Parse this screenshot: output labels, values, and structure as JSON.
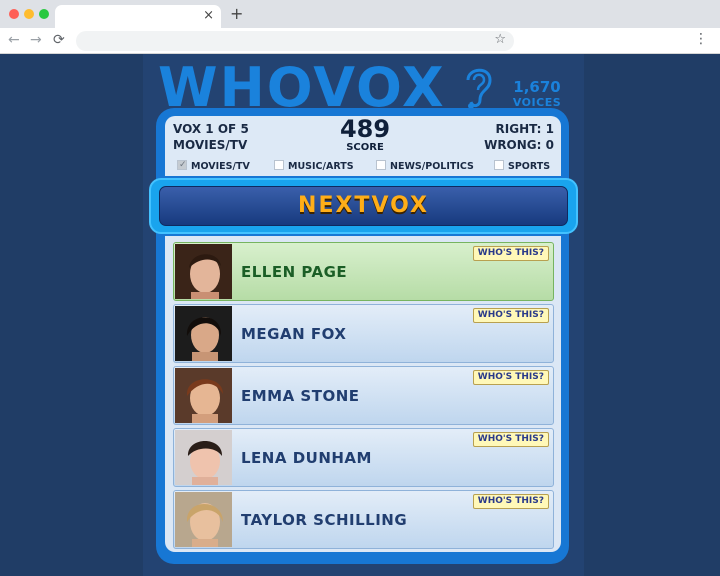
{
  "browser": {
    "tab_close": "×",
    "new_tab": "+",
    "back": "←",
    "forward": "→",
    "reload": "⟳",
    "star": "☆",
    "menu": "⋮",
    "dot_colors": [
      "#fe5f57",
      "#febc2e",
      "#28c840"
    ]
  },
  "header": {
    "logo": "WHOVOX",
    "voices_count": "1,670",
    "voices_label": "VOICES",
    "icon": "ear-icon"
  },
  "status": {
    "vox_label": "VOX",
    "vox_current": "1",
    "vox_of": "OF",
    "vox_total": "5",
    "category": "MOVIES/TV",
    "score": "489",
    "score_label": "SCORE",
    "right_label": "RIGHT:",
    "right_value": "1",
    "wrong_label": "WRONG:",
    "wrong_value": "0"
  },
  "filters": [
    {
      "label": "MOVIES/TV",
      "checked": true
    },
    {
      "label": "MUSIC/ARTS",
      "checked": false
    },
    {
      "label": "NEWS/POLITICS",
      "checked": false
    },
    {
      "label": "SPORTS",
      "checked": false
    }
  ],
  "next_button": "NEXTVOX",
  "answers": [
    {
      "name": "ELLEN PAGE",
      "whos_this": "WHO'S THIS?",
      "correct": true
    },
    {
      "name": "MEGAN FOX",
      "whos_this": "WHO'S THIS?",
      "correct": false
    },
    {
      "name": "EMMA STONE",
      "whos_this": "WHO'S THIS?",
      "correct": false
    },
    {
      "name": "LENA DUNHAM",
      "whos_this": "WHO'S THIS?",
      "correct": false
    },
    {
      "name": "TAYLOR SCHILLING",
      "whos_this": "WHO'S THIS?",
      "correct": false
    }
  ],
  "colors": {
    "page_bg": "#203d66",
    "brand_blue": "#1a82dc",
    "next_text": "#ffae18",
    "correct_green": "#1b5e26"
  }
}
